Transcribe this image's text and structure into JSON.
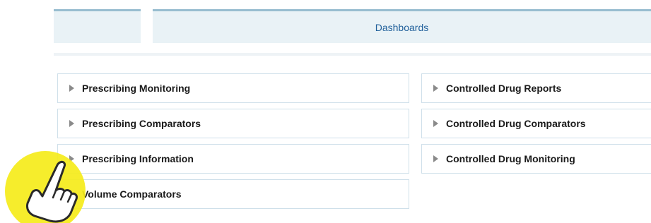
{
  "tabs": {
    "main_label": "Dashboards"
  },
  "reports": {
    "left": [
      {
        "label": "Prescribing Monitoring"
      },
      {
        "label": "Prescribing Comparators"
      },
      {
        "label": "Prescribing Information"
      },
      {
        "label": "Volume Comparators"
      }
    ],
    "right": [
      {
        "label": "Controlled Drug Reports"
      },
      {
        "label": "Controlled Drug Comparators"
      },
      {
        "label": "Controlled Drug Monitoring"
      }
    ]
  },
  "colors": {
    "tab_accent": "#98bdd0",
    "tab_bg": "#e9f2f6",
    "link_text": "#1f5f9a",
    "item_border": "#cfe0ea",
    "hand_highlight": "#f5ec1a"
  },
  "icons": {
    "expand": "triangle-right-icon",
    "pointer": "hand-pointer-icon"
  }
}
